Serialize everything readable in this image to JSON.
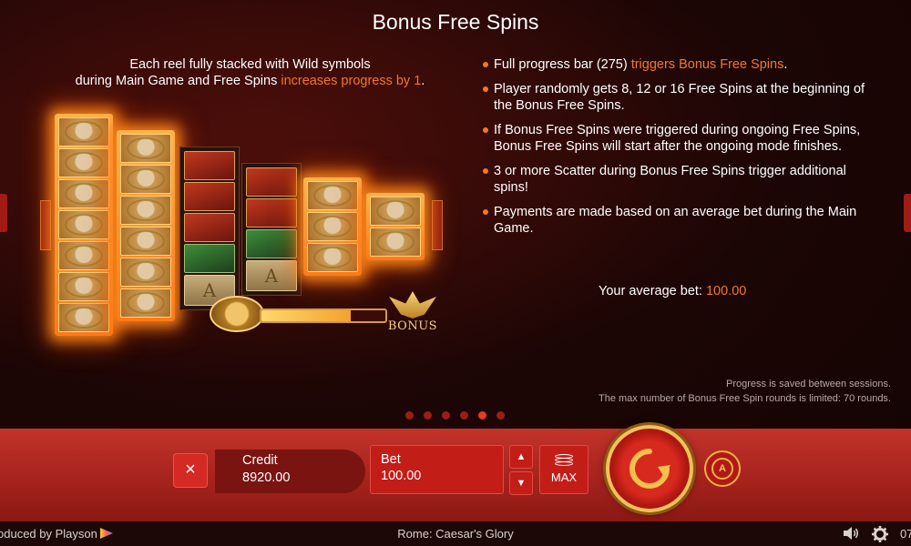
{
  "info": {
    "title": "Bonus Free Spins",
    "intro_line1": "Each reel fully stacked with Wild symbols",
    "intro_line2_prefix": "during Main Game and Free Spins ",
    "intro_line2_accent": "increases progress by 1",
    "intro_line2_suffix": ".",
    "rules": [
      {
        "text": "Full progress bar (275) ",
        "accent": "triggers Bonus Free Spins",
        "suffix": "."
      },
      {
        "text": "Player randomly gets 8, 12 or 16 Free Spins at the beginning of the Bonus Free Spins.",
        "accent": "",
        "suffix": ""
      },
      {
        "text": "If Bonus Free Spins were triggered during ongoing Free Spins, Bonus Free Spins will start after the ongoing mode finishes.",
        "accent": "",
        "suffix": ""
      },
      {
        "text": "3 or more Scatter during Bonus Free Spins trigger additional spins!",
        "accent": "",
        "suffix": ""
      },
      {
        "text": "Payments are made based on an average bet during the Main Game.",
        "accent": "",
        "suffix": ""
      }
    ],
    "avg_bet_label": "Your average bet:",
    "avg_bet_value": "100.00",
    "note_progress_saved": "Progress is saved between sessions.",
    "note_max_rounds": "The max number of Bonus Free Spin rounds is limited: 70 rounds.",
    "illustration": {
      "bonus_label": "BONUS",
      "scatter_letter": "A",
      "progress_fraction": 0.72
    },
    "pager": {
      "pages": 6,
      "active_index": 4
    }
  },
  "controls": {
    "close_icon": "×",
    "credit_label": "Credit",
    "credit_value": "8920.00",
    "bet_label": "Bet",
    "bet_value": "100.00",
    "bet_up_icon": "▲",
    "bet_down_icon": "▼",
    "max_label": "MAX",
    "autoplay_letter": "A"
  },
  "footer": {
    "produced_by": "oduced by Playson",
    "game_title": "Rome: Caesar's Glory",
    "clock": "07"
  },
  "colors": {
    "accent": "#f0782a",
    "control_bar": "#b1281f",
    "gold": "#f2c15a"
  }
}
